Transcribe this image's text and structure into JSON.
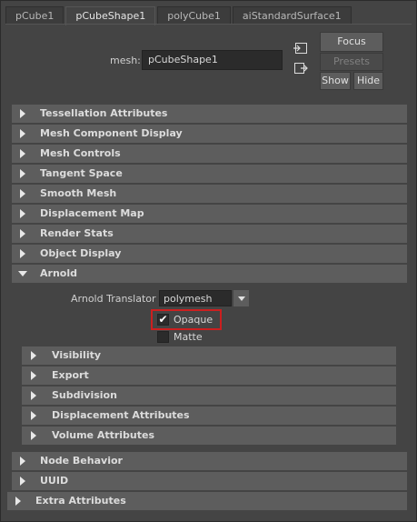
{
  "tabs": [
    "pCube1",
    "pCubeShape1",
    "polyCube1",
    "aiStandardSurface1"
  ],
  "active_tab": "pCubeShape1",
  "mesh": {
    "label": "mesh:",
    "value": "pCubeShape1"
  },
  "buttons": {
    "focus": "Focus",
    "presets": "Presets",
    "show": "Show",
    "hide": "Hide"
  },
  "icons": [
    "input-connection-icon",
    "output-connection-icon"
  ],
  "sections_top": [
    "Tessellation Attributes",
    "Mesh Component Display",
    "Mesh Controls",
    "Tangent Space",
    "Smooth Mesh",
    "Displacement Map",
    "Render Stats",
    "Object Display"
  ],
  "arnold": {
    "title": "Arnold",
    "translator_label": "Arnold Translator",
    "translator_value": "polymesh",
    "opaque": {
      "label": "Opaque",
      "checked": true
    },
    "matte": {
      "label": "Matte",
      "checked": false
    },
    "subsections": [
      "Visibility",
      "Export",
      "Subdivision",
      "Displacement Attributes",
      "Volume Attributes"
    ]
  },
  "sections_bottom": [
    "Node Behavior",
    "UUID"
  ],
  "extra": "Extra Attributes",
  "highlight_color": "#cc1f1f"
}
